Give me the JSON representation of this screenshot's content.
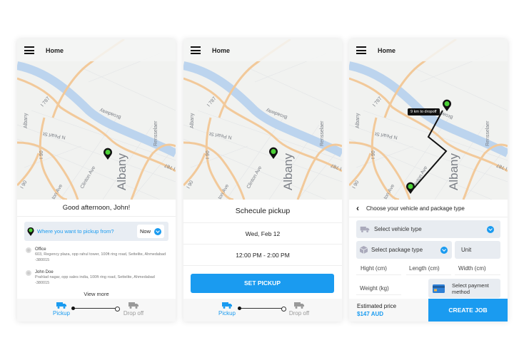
{
  "map_labels": {
    "albany_small": "Albany",
    "albany_big": "Albany",
    "n_pearl": "N Pearl St",
    "broadway": "Broadway",
    "rensselaer": "Rensselaer",
    "i787_a": "I 787",
    "i787_b": "I 787",
    "i90_a": "I 90",
    "i90_b": "I 90",
    "clinton_ave": "Clinton Ave",
    "clinton_ave_2": "ton Ave"
  },
  "colors": {
    "accent": "#1a9bf0",
    "river": "#bcd4ee",
    "highway": "#f2c99a",
    "pin_green": "#4cd137"
  },
  "screen1": {
    "header": {
      "title": "Home"
    },
    "greeting": "Good afternoon, John!",
    "pickup_prompt": "Where you want to pickup from?",
    "time_select": "Now",
    "addresses": [
      {
        "name": "Office",
        "address": "603, Regency plaza, opp rahul tower, 100ft ring road, Settelite, Ahmedabad -380015"
      },
      {
        "name": "John Doe",
        "address": "Prahlad nagar, opp sales india, 100ft ring road, Settelite, Ahmedabad -380015"
      }
    ],
    "view_more": "View more",
    "nav": {
      "pickup": "Pickup",
      "dropoff": "Drop off"
    }
  },
  "screen2": {
    "header": {
      "title": "Home"
    },
    "title": "Schecule pickup",
    "date": "Wed, Feb 12",
    "time_range": "12:00 PM - 2:00 PM",
    "button": "SET PICKUP",
    "nav": {
      "pickup": "Pickup",
      "dropoff": "Drop off"
    }
  },
  "screen3": {
    "header": {
      "title": "Home"
    },
    "route_tooltip": "9 km to dropoff",
    "title": "Choose your vehicle and package type",
    "vehicle_select": "Select vehicle type",
    "package_select": "Select package type",
    "unit": "Unit",
    "height": "Hight (cm)",
    "length": "Length (cm)",
    "width": "Width (cm)",
    "weight": "Weight (kg)",
    "payment": "Select payment method",
    "estimated_label": "Estimated  price",
    "estimated_value": "$147 AUD",
    "create_job": "CREATE JOB"
  }
}
